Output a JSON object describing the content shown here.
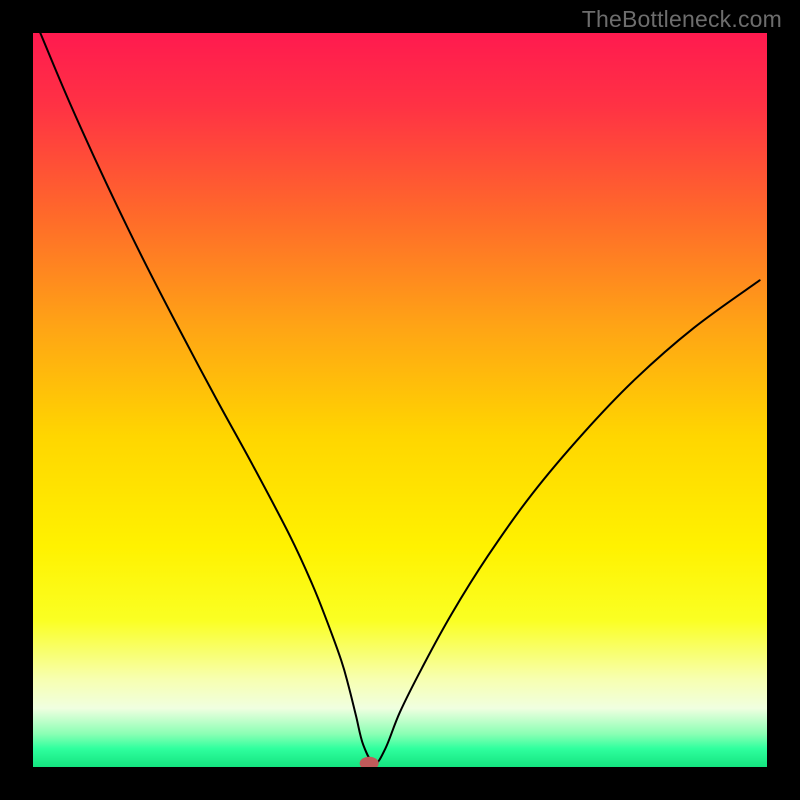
{
  "watermark": "TheBottleneck.com",
  "chart_data": {
    "type": "line",
    "title": "",
    "xlabel": "",
    "ylabel": "",
    "xlim": [
      0,
      100
    ],
    "ylim": [
      0,
      100
    ],
    "grid": false,
    "legend": false,
    "gradient_stops": [
      {
        "offset": 0.0,
        "color": "#ff1a4f"
      },
      {
        "offset": 0.1,
        "color": "#ff3244"
      },
      {
        "offset": 0.25,
        "color": "#ff6a2a"
      },
      {
        "offset": 0.4,
        "color": "#ffa415"
      },
      {
        "offset": 0.55,
        "color": "#ffd600"
      },
      {
        "offset": 0.7,
        "color": "#fff200"
      },
      {
        "offset": 0.8,
        "color": "#faff23"
      },
      {
        "offset": 0.88,
        "color": "#f7ffb0"
      },
      {
        "offset": 0.92,
        "color": "#f0ffe0"
      },
      {
        "offset": 0.955,
        "color": "#8affb4"
      },
      {
        "offset": 0.975,
        "color": "#2fff9e"
      },
      {
        "offset": 1.0,
        "color": "#14e47f"
      }
    ],
    "series": [
      {
        "name": "bottleneck-curve",
        "stroke": "#000000",
        "stroke_width": 2,
        "x": [
          1,
          5,
          10,
          15,
          20,
          25,
          30,
          35,
          38,
          40,
          42,
          43,
          44,
          45,
          46.5,
          48,
          50,
          53,
          57,
          62,
          68,
          75,
          82,
          90,
          99
        ],
        "y": [
          100,
          90.5,
          79.5,
          69.2,
          59.5,
          50.1,
          41,
          31.5,
          25,
          20,
          14.5,
          11,
          7,
          3,
          0.5,
          2.5,
          7.5,
          13.5,
          20.8,
          28.8,
          37.2,
          45.5,
          52.8,
          59.8,
          66.3
        ]
      }
    ],
    "marker": {
      "name": "min-point-marker",
      "cx": 45.8,
      "cy": 0.5,
      "rx": 1.3,
      "ry": 0.9,
      "fill": "#c05a5a"
    }
  }
}
